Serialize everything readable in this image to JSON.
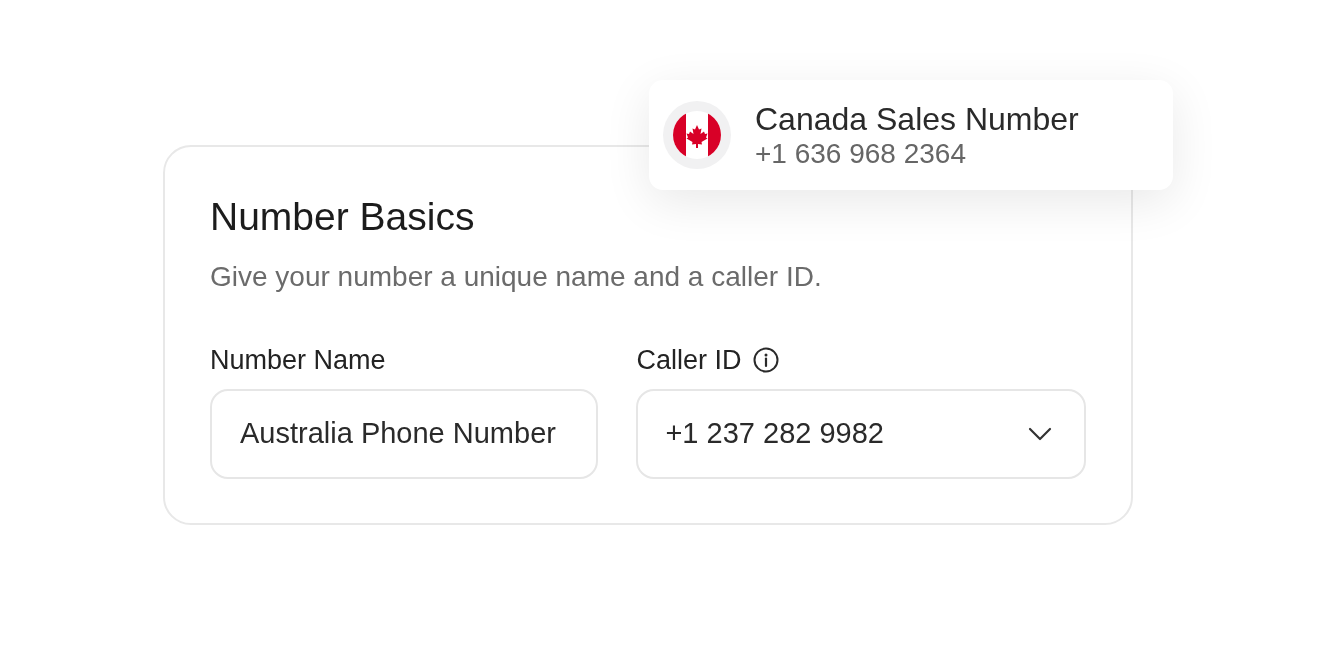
{
  "card": {
    "title": "Number Basics",
    "subtitle": "Give your number a unique name and a caller ID."
  },
  "fields": [
    {
      "kind": "text",
      "label": "Number Name",
      "value": "Australia Phone Number",
      "info": false
    },
    {
      "kind": "select",
      "label": "Caller ID",
      "value": "+1 237 282 9982",
      "info": true
    }
  ],
  "popup": {
    "name": "Canada Sales Number",
    "number": "+1 636 968 2364"
  }
}
